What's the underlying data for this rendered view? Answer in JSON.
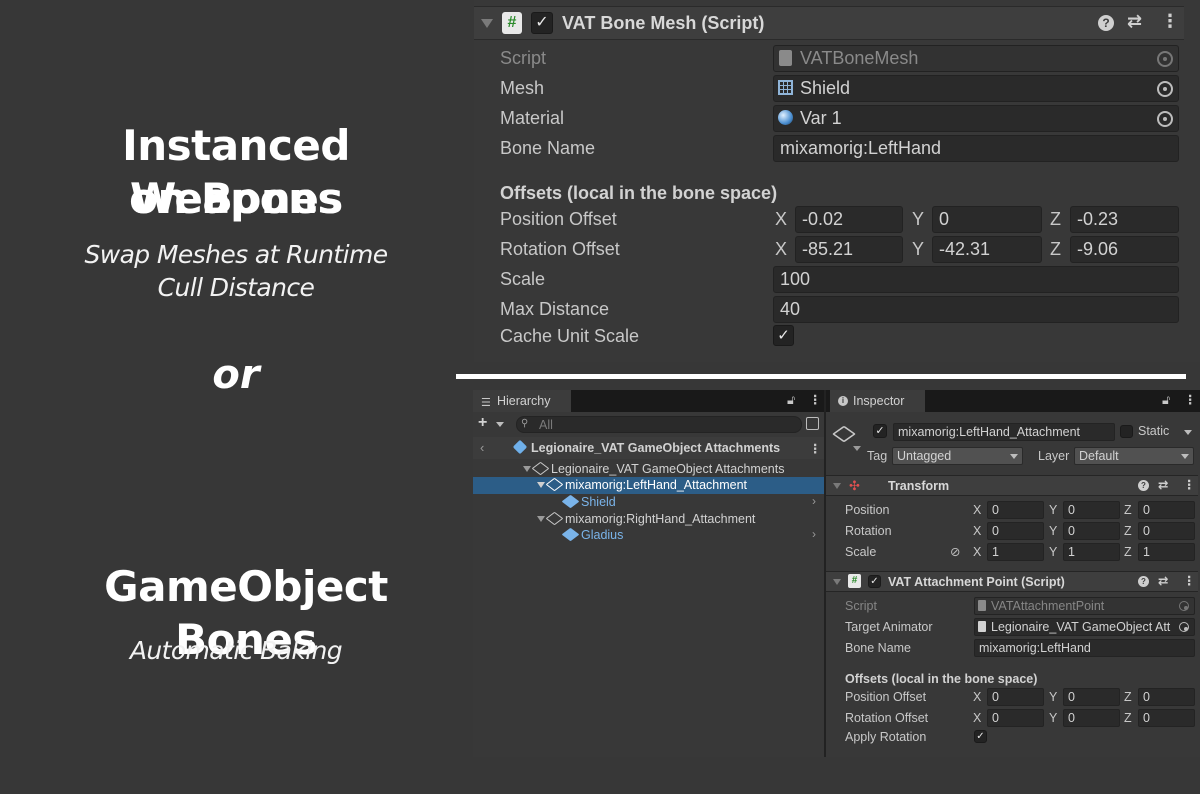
{
  "promo": {
    "title1_line1": "Instanced Weapons",
    "title1_line2": "on Bones",
    "sub1_line1": "Swap Meshes at Runtime",
    "sub1_line2": "Cull Distance",
    "or": "or",
    "title2": "GameObject Bones",
    "sub2": "Automatic Baking"
  },
  "top_component": {
    "title": "VAT Bone Mesh (Script)",
    "script_label": "Script",
    "script_value": "VATBoneMesh",
    "mesh_label": "Mesh",
    "mesh_value": "Shield",
    "material_label": "Material",
    "material_value": "Var 1",
    "bone_name_label": "Bone Name",
    "bone_name_value": "mixamorig:LeftHand",
    "offsets_header": "Offsets (local in the bone space)",
    "position_offset_label": "Position Offset",
    "position_offset": {
      "x": "-0.02",
      "y": "0",
      "z": "-0.23"
    },
    "rotation_offset_label": "Rotation Offset",
    "rotation_offset": {
      "x": "-85.21",
      "y": "-42.31",
      "z": "-9.06"
    },
    "scale_label": "Scale",
    "scale_value": "100",
    "max_distance_label": "Max Distance",
    "max_distance_value": "40",
    "cache_unit_scale_label": "Cache Unit Scale",
    "cache_unit_scale_checked": true,
    "axis_x": "X",
    "axis_y": "Y",
    "axis_z": "Z"
  },
  "hierarchy": {
    "tab_label": "Hierarchy",
    "search_placeholder": "All",
    "scene_title": "Legionaire_VAT GameObject Attachments",
    "items": [
      {
        "label": "Legionaire_VAT GameObject Attachments"
      },
      {
        "label": "mixamorig:LeftHand_Attachment"
      },
      {
        "label": "Shield"
      },
      {
        "label": "mixamorig:RightHand_Attachment"
      },
      {
        "label": "Gladius"
      }
    ]
  },
  "inspector": {
    "tab_label": "Inspector",
    "object_name": "mixamorig:LeftHand_Attachment",
    "static_label": "Static",
    "tag_label": "Tag",
    "tag_value": "Untagged",
    "layer_label": "Layer",
    "layer_value": "Default",
    "transform": {
      "title": "Transform",
      "position_label": "Position",
      "position": {
        "x": "0",
        "y": "0",
        "z": "0"
      },
      "rotation_label": "Rotation",
      "rotation": {
        "x": "0",
        "y": "0",
        "z": "0"
      },
      "scale_label": "Scale",
      "scale": {
        "x": "1",
        "y": "1",
        "z": "1"
      }
    },
    "attachment": {
      "title": "VAT Attachment Point (Script)",
      "script_label": "Script",
      "script_value": "VATAttachmentPoint",
      "target_animator_label": "Target Animator",
      "target_animator_value": "Legionaire_VAT GameObject Att",
      "bone_name_label": "Bone Name",
      "bone_name_value": "mixamorig:LeftHand",
      "offsets_header": "Offsets (local in the bone space)",
      "position_offset_label": "Position Offset",
      "position_offset": {
        "x": "0",
        "y": "0",
        "z": "0"
      },
      "rotation_offset_label": "Rotation Offset",
      "rotation_offset": {
        "x": "0",
        "y": "0",
        "z": "0"
      },
      "apply_rotation_label": "Apply Rotation",
      "apply_rotation_checked": true
    },
    "axis_x": "X",
    "axis_y": "Y",
    "axis_z": "Z"
  },
  "colors": {
    "background": "#373737",
    "selection": "#2c5d87",
    "prefab_blue": "#7ab4ea"
  }
}
